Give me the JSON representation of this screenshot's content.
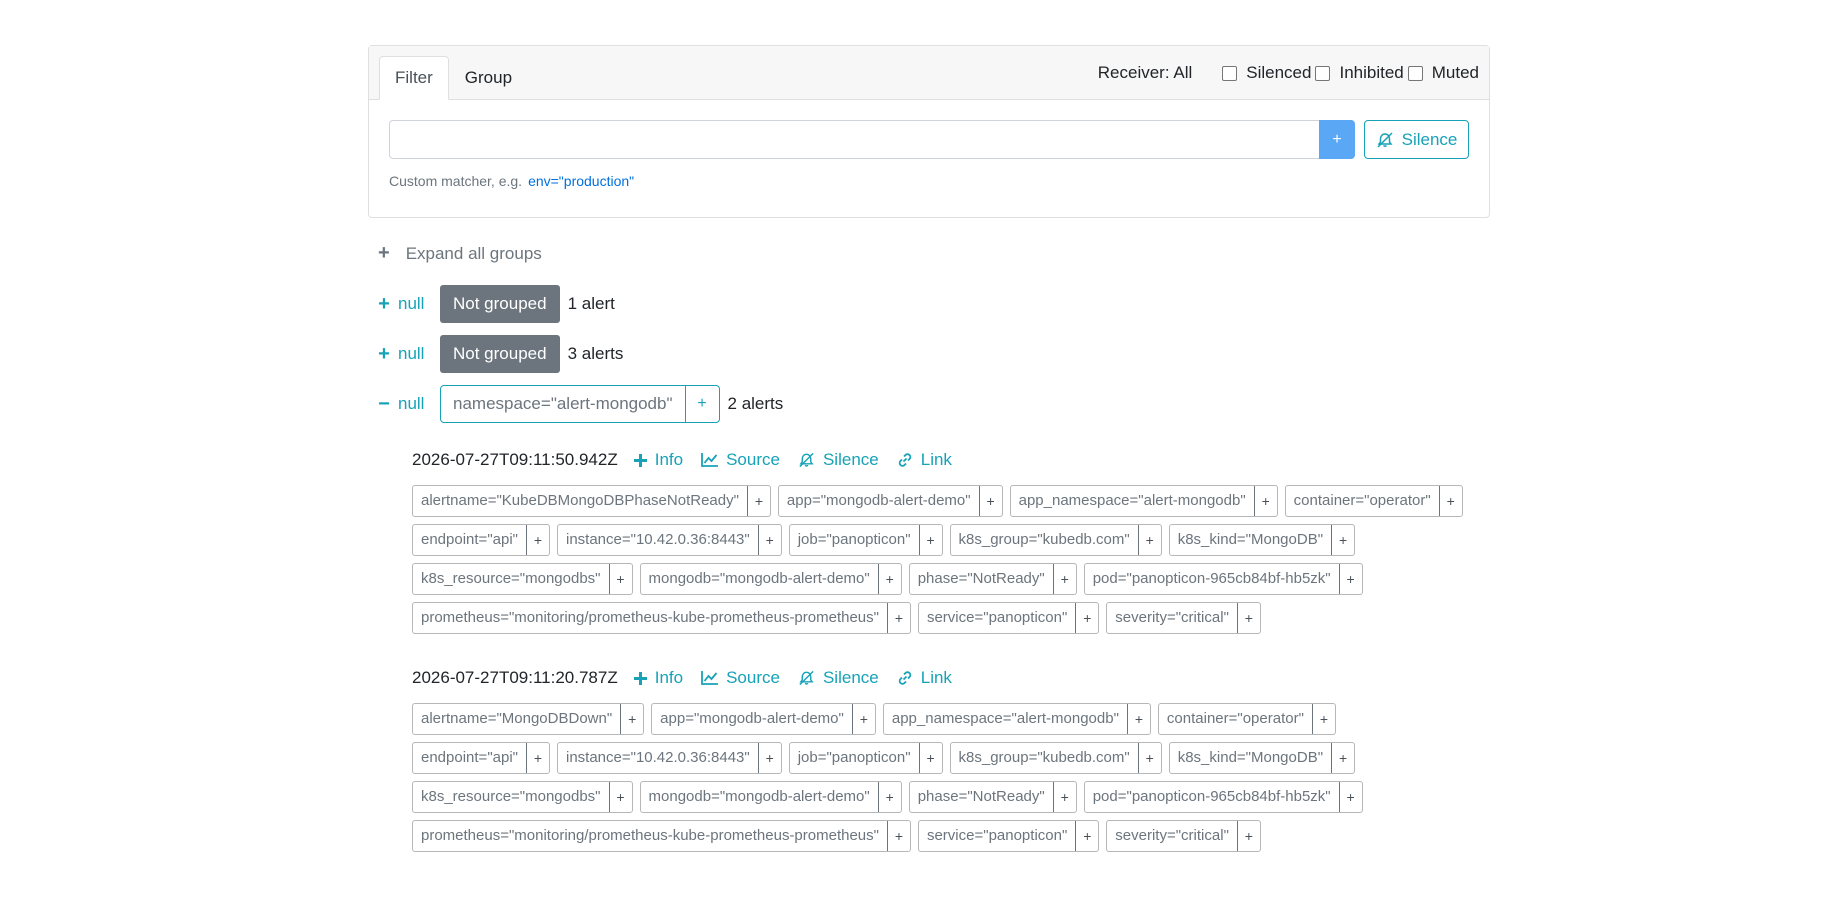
{
  "filter_card": {
    "tabs": [
      "Filter",
      "Group"
    ],
    "receiver_label": "Receiver: All",
    "checkboxes": [
      "Silenced",
      "Inhibited",
      "Muted"
    ],
    "input_value": "",
    "plus_label": "+",
    "silence_label": "Silence",
    "hint_text": "Custom matcher, e.g.",
    "hint_example": "env=\"production\""
  },
  "expand_all": {
    "icon": "+",
    "label": "Expand all groups"
  },
  "groups": [
    {
      "toggle_icon": "+",
      "name": "null",
      "badge": "Not grouped",
      "count": "1 alert"
    },
    {
      "toggle_icon": "+",
      "name": "null",
      "badge": "Not grouped",
      "count": "3 alerts"
    },
    {
      "toggle_icon": "−",
      "name": "null",
      "label": "namespace=\"alert-mongodb\"",
      "label_plus": "+",
      "count": "2 alerts"
    }
  ],
  "actions": {
    "info": "Info",
    "source": "Source",
    "silence": "Silence",
    "link": "Link"
  },
  "alerts": [
    {
      "time": "2026-07-27T09:11:50.942Z",
      "labels": [
        "alertname=\"KubeDBMongoDBPhaseNotReady\"",
        "app=\"mongodb-alert-demo\"",
        "app_namespace=\"alert-mongodb\"",
        "container=\"operator\"",
        "endpoint=\"api\"",
        "instance=\"10.42.0.36:8443\"",
        "job=\"panopticon\"",
        "k8s_group=\"kubedb.com\"",
        "k8s_kind=\"MongoDB\"",
        "k8s_resource=\"mongodbs\"",
        "mongodb=\"mongodb-alert-demo\"",
        "phase=\"NotReady\"",
        "pod=\"panopticon-965cb84bf-hb5zk\"",
        "prometheus=\"monitoring/prometheus-kube-prometheus-prometheus\"",
        "service=\"panopticon\"",
        "severity=\"critical\""
      ]
    },
    {
      "time": "2026-07-27T09:11:20.787Z",
      "labels": [
        "alertname=\"MongoDBDown\"",
        "app=\"mongodb-alert-demo\"",
        "app_namespace=\"alert-mongodb\"",
        "container=\"operator\"",
        "endpoint=\"api\"",
        "instance=\"10.42.0.36:8443\"",
        "job=\"panopticon\"",
        "k8s_group=\"kubedb.com\"",
        "k8s_kind=\"MongoDB\"",
        "k8s_resource=\"mongodbs\"",
        "mongodb=\"mongodb-alert-demo\"",
        "phase=\"NotReady\"",
        "pod=\"panopticon-965cb84bf-hb5zk\"",
        "prometheus=\"monitoring/prometheus-kube-prometheus-prometheus\"",
        "service=\"panopticon\"",
        "severity=\"critical\""
      ]
    }
  ],
  "label_plus": "+",
  "colors": {
    "accent": "#17a2b8",
    "primary_button": "#5aa8f5",
    "badge_dark": "#6c757d",
    "link": "#0070dd"
  },
  "icons": {
    "info": "plus-icon",
    "source": "chart-line-icon",
    "silence": "bell-slash-icon",
    "link": "link-icon"
  }
}
